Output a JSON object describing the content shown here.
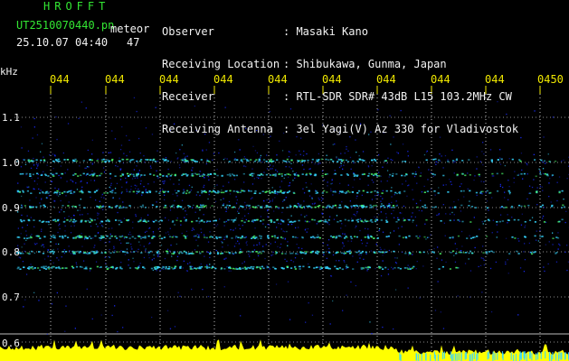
{
  "app": {
    "title": "HROFFT",
    "file_name": "UT2510070440.pn",
    "meteor_label": "meteor",
    "datetime": "25.10.07 04:40",
    "count": "47"
  },
  "observation": {
    "labels": [
      "Observer",
      "Receiving Location",
      "Receiver",
      "Receiving Antenna"
    ],
    "values": [
      ": Masaki Kano",
      ": Shibukawa, Gunma, Japan",
      ": RTL-SDR SDR# 43dB L15 103.2MHz CW",
      ": 3el Yagi(V) Az 330 for Vladivostok"
    ]
  },
  "axis": {
    "unit": "kHz",
    "time_ticks": [
      "044",
      "044",
      "044",
      "044",
      "044",
      "044",
      "044",
      "044",
      "044",
      "0450"
    ],
    "freq_ticks": [
      "1.1",
      "1.0",
      "0.9",
      "0.8",
      "0.7",
      "0.6"
    ]
  },
  "colors": {
    "text_green": "#33e633",
    "text_white": "#f2f2f2",
    "tick_yellow": "#f0e800",
    "noise_blue": "#1a2bff",
    "signal_cyan": "#35d6ff",
    "signal_green": "#4dff6a",
    "power_yellow": "#ffff00"
  }
}
